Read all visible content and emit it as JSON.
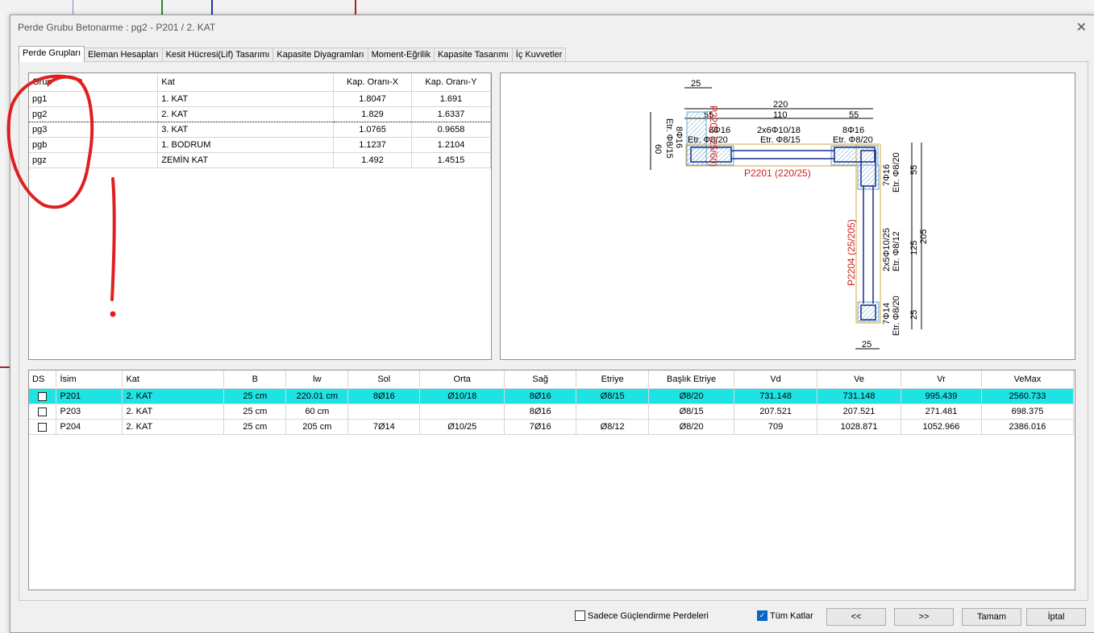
{
  "window": {
    "title": "Perde Grubu Betonarme  :  pg2 - P201 / 2. KAT"
  },
  "tabs": [
    "Perde Grupları",
    "Eleman Hesapları",
    "Kesit Hücresi(Lif) Tasarımı",
    "Kapasite Diyagramları",
    "Moment-Eğrilik",
    "Kapasite Tasarımı",
    "İç Kuvvetler"
  ],
  "groups": {
    "headers": [
      "Grup",
      "Kat",
      "Kap. Oranı-X",
      "Kap. Oranı-Y"
    ],
    "rows": [
      [
        "pg1",
        "1. KAT",
        "1.8047",
        "1.691"
      ],
      [
        "pg2",
        "2. KAT",
        "1.829",
        "1.6337"
      ],
      [
        "pg3",
        "3. KAT",
        "1.0765",
        "0.9658"
      ],
      [
        "pgb",
        "1. BODRUM",
        "1.1237",
        "1.2104"
      ],
      [
        "pgz",
        "ZEMİN KAT",
        "1.492",
        "1.4515"
      ]
    ]
  },
  "drawing": {
    "dims": {
      "top25": "25",
      "top220": "220",
      "top55a": "55",
      "top110": "110",
      "top55b": "55",
      "left60": "60",
      "right55": "55",
      "right205": "205",
      "right125": "125",
      "right25": "25",
      "bottom25": "25"
    },
    "labels": {
      "left_bars": "8Φ16",
      "left_etr": "Etr. Φ8/20",
      "mid_bars": "2x6Φ10/18",
      "mid_etr": "Etr. Φ8/15",
      "right_bars": "8Φ16",
      "right_etr": "Etr. Φ8/20",
      "v_left1": "8Φ16",
      "v_left2": "Etr. Φ8/15",
      "wall1": "P2201 (220/25)",
      "wall2": "P2204 (25/205)",
      "wall3": "P2203 (25/60)",
      "corner_bars": "7Φ16",
      "corner_etr": "Etr. Φ8/20",
      "web_bars": "2x5Φ10/25",
      "web_etr": "Etr. Φ8/12",
      "bot_bars": "7Φ14",
      "bot_etr": "Etr. Φ8/20"
    }
  },
  "members": {
    "headers": [
      "DS",
      "İsim",
      "Kat",
      "B",
      "lw",
      "Sol",
      "Orta",
      "Sağ",
      "Etriye",
      "Başlık Etriye",
      "Vd",
      "Ve",
      "Vr",
      "VeMax"
    ],
    "rows": [
      [
        "",
        "P201",
        "2. KAT",
        "25 cm",
        "220.01 cm",
        "8Ø16",
        "Ø10/18",
        "8Ø16",
        "Ø8/15",
        "Ø8/20",
        "731.148",
        "731.148",
        "995.439",
        "2560.733"
      ],
      [
        "",
        "P203",
        "2. KAT",
        "25 cm",
        "60 cm",
        "",
        "",
        "8Ø16",
        "",
        "Ø8/15",
        "207.521",
        "207.521",
        "271.481",
        "698.375"
      ],
      [
        "",
        "P204",
        "2. KAT",
        "25 cm",
        "205 cm",
        "7Ø14",
        "Ø10/25",
        "7Ø16",
        "Ø8/12",
        "Ø8/20",
        "709",
        "1028.871",
        "1052.966",
        "2386.016"
      ]
    ]
  },
  "footer": {
    "only_strengthen": "Sadece Güçlendirme Perdeleri",
    "all_floors": "Tüm Katlar",
    "prev": "<<",
    "next": ">>",
    "ok": "Tamam",
    "cancel": "İptal"
  },
  "colors": {
    "highlight": "#1ee3e3",
    "annotation": "#e02020",
    "wall_label": "#d21c1c"
  }
}
